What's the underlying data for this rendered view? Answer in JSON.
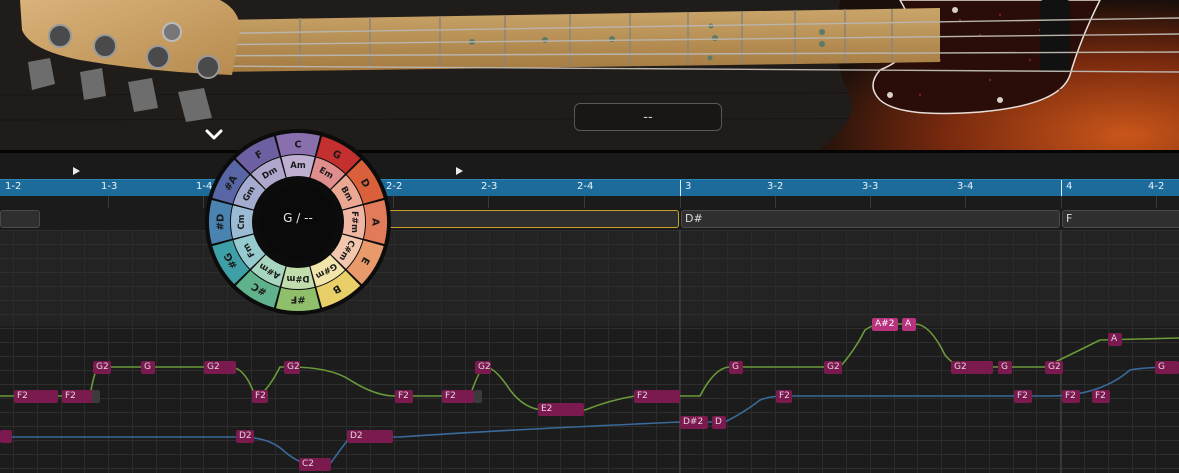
{
  "display": {
    "value": "--"
  },
  "ruler": {
    "labels": [
      "1-2",
      "1-3",
      "1-4",
      "2-2",
      "2-3",
      "2-4",
      "3",
      "3-2",
      "3-3",
      "3-4",
      "4",
      "4-2"
    ]
  },
  "chord_track": {
    "blocks": [
      {
        "label": ""
      },
      {
        "label": "D#"
      },
      {
        "label": "F"
      }
    ]
  },
  "chord_wheel": {
    "center_label": "G / --",
    "outer": [
      "C",
      "G",
      "D",
      "A",
      "E",
      "B",
      "#F",
      "#C",
      "#G",
      "#D",
      "#A",
      "F"
    ],
    "middle": [
      "Am",
      "Em",
      "Bm",
      "F#m",
      "C#m",
      "G#m",
      "D#m",
      "A#m",
      "Fm",
      "Cm",
      "Gm",
      "Dm"
    ],
    "colors": [
      "#8a6fae",
      "#c42f2f",
      "#d9603b",
      "#e27b5a",
      "#e89a6a",
      "#e8cf68",
      "#8fbf6a",
      "#5fb28c",
      "#3f9fa6",
      "#4a82b0",
      "#5866a6",
      "#6e5fa3"
    ]
  },
  "notes": {
    "upper": [
      "F2",
      "F2",
      "G2",
      "G",
      "G2",
      "F2",
      "G2",
      "F2",
      "F2",
      "G2",
      "E2",
      "F2",
      "G",
      "G2",
      "A#2",
      "A",
      "G2",
      "G",
      "G2",
      "A"
    ],
    "lower": [
      "D2",
      "C2",
      "D2",
      "D#2",
      "D",
      "F2",
      "F2",
      "F2",
      "F2",
      "G"
    ]
  },
  "icons": {
    "wheel_toggle": "chevron-down-icon",
    "play_marker": "play-icon"
  }
}
